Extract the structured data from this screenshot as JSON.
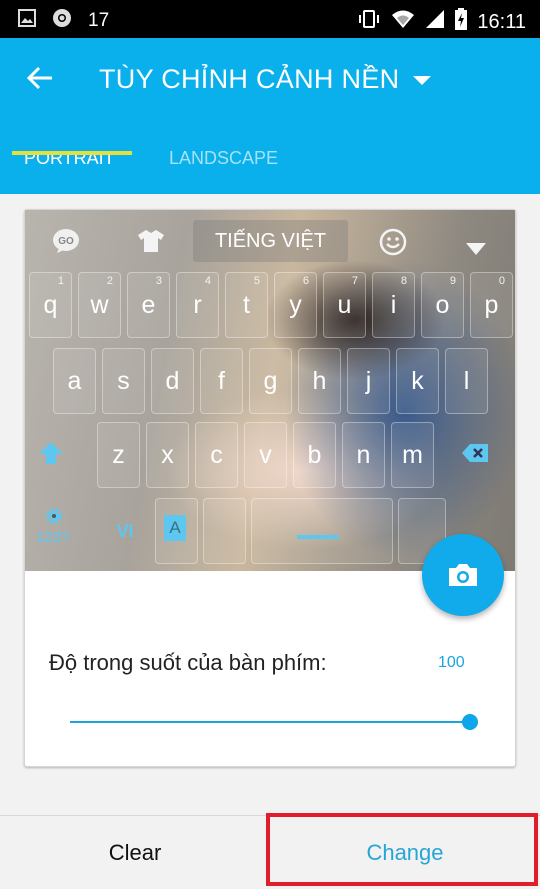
{
  "status_bar": {
    "notification_count": "17",
    "time": "16:11",
    "icons": [
      "image-icon",
      "chrome-icon",
      "vibrate-icon",
      "wifi-icon",
      "signal-icon",
      "battery-charging-icon"
    ]
  },
  "app_bar": {
    "back_icon": "arrow-left-icon",
    "title": "TÙY CHỈNH CẢNH NỀN",
    "dropdown_icon": "caret-down-icon",
    "tabs": [
      {
        "label": "PORTRAIT",
        "active": true
      },
      {
        "label": "LANDSCAPE",
        "active": false
      }
    ]
  },
  "preview": {
    "toolbar": {
      "go_icon": "GO",
      "theme_icon": "shirt-icon",
      "language": "TIẾNG VIỆT",
      "emoji_icon": "smiley-icon",
      "collapse_icon": "triangle-down-icon"
    },
    "rows": [
      {
        "keys": [
          {
            "ch": "q",
            "hint": "1"
          },
          {
            "ch": "w",
            "hint": "2"
          },
          {
            "ch": "e",
            "hint": "3"
          },
          {
            "ch": "r",
            "hint": "4"
          },
          {
            "ch": "t",
            "hint": "5"
          },
          {
            "ch": "y",
            "hint": "6"
          },
          {
            "ch": "u",
            "hint": "7"
          },
          {
            "ch": "i",
            "hint": "8"
          },
          {
            "ch": "o",
            "hint": "9"
          },
          {
            "ch": "p",
            "hint": "0"
          }
        ]
      },
      {
        "keys": [
          {
            "ch": "a"
          },
          {
            "ch": "s"
          },
          {
            "ch": "d"
          },
          {
            "ch": "f"
          },
          {
            "ch": "g"
          },
          {
            "ch": "h"
          },
          {
            "ch": "j"
          },
          {
            "ch": "k"
          },
          {
            "ch": "l"
          }
        ]
      },
      {
        "keys": [
          {
            "ch": "⇧"
          },
          {
            "ch": "z"
          },
          {
            "ch": "x"
          },
          {
            "ch": "c"
          },
          {
            "ch": "v"
          },
          {
            "ch": "b"
          },
          {
            "ch": "n"
          },
          {
            "ch": "m"
          },
          {
            "ch": "⌫"
          }
        ]
      }
    ],
    "bottom_row": {
      "settings_label": "123?",
      "lang_key": "VI",
      "input_key": "A"
    },
    "camera_icon": "camera-icon"
  },
  "opacity": {
    "label": "Độ trong suốt của bàn phím:",
    "value": "100",
    "slider_fraction": 1.0
  },
  "actions": {
    "clear_label": "Clear",
    "change_label": "Change",
    "highlight_color": "#e01e2b",
    "accent_color": "#0ab0ec"
  }
}
